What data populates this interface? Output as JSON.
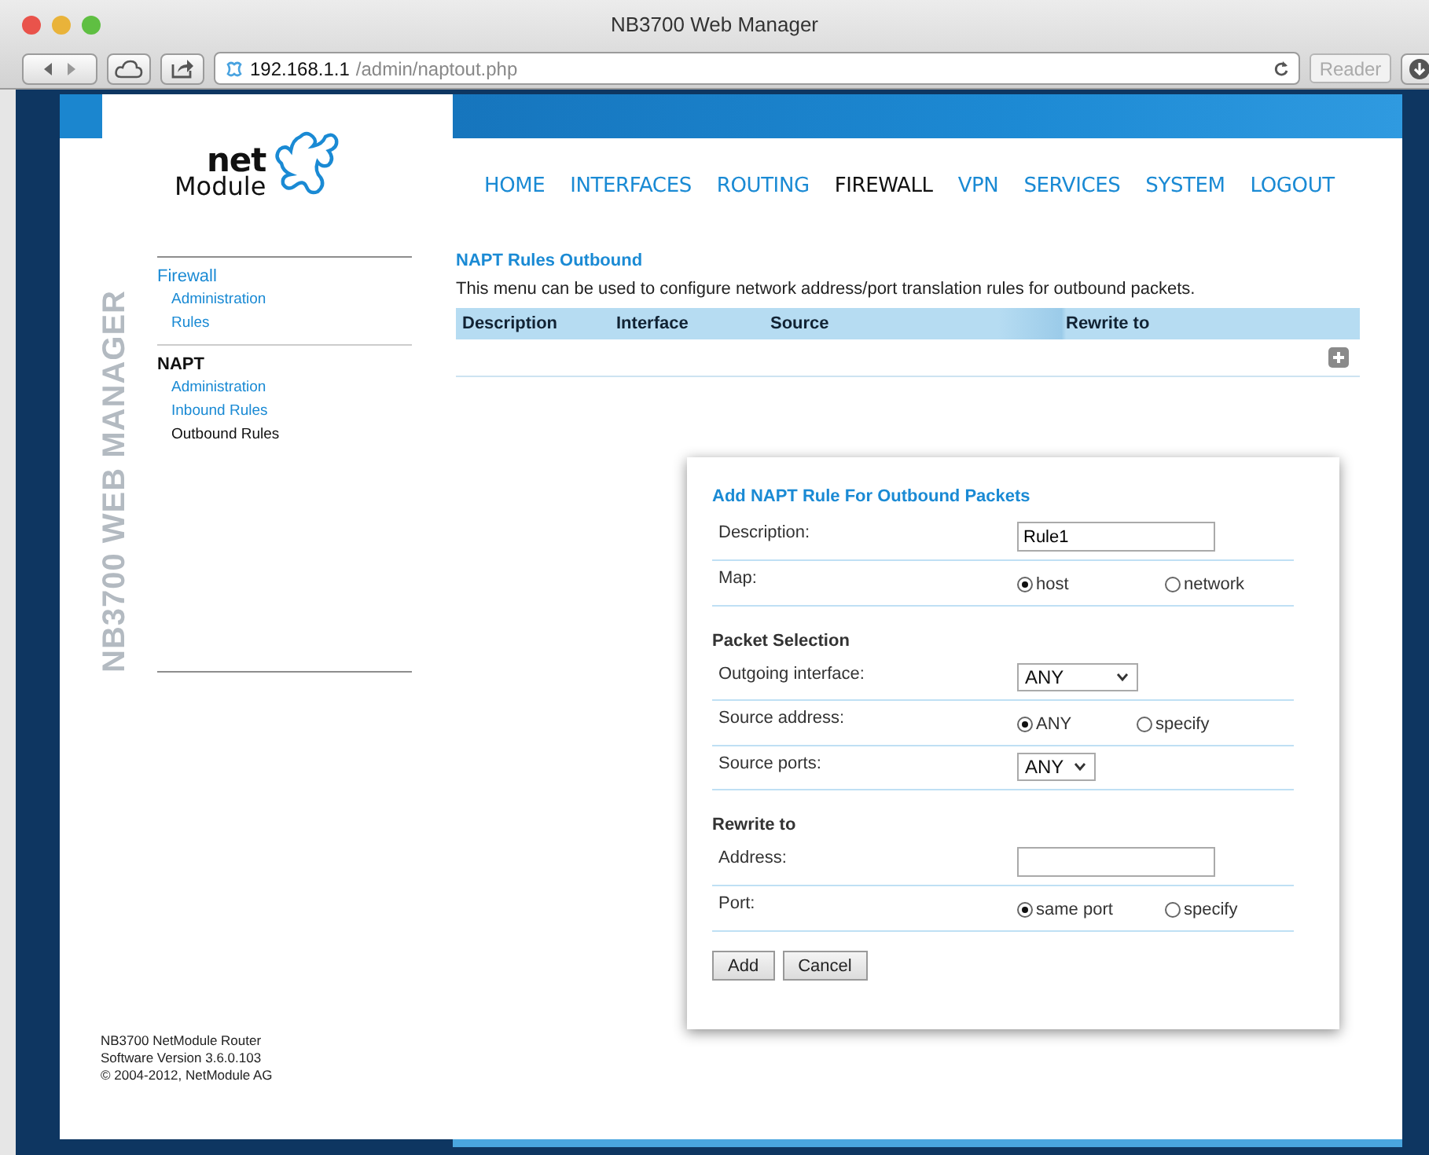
{
  "browser": {
    "title": "NB3700 Web Manager",
    "url_host": "192.168.1.1",
    "url_path": "/admin/naptout.php",
    "reader": "Reader"
  },
  "brand": {
    "logo_top": "net",
    "logo_bottom": "Module",
    "side_title": "NB3700 WEB MANAGER"
  },
  "main_menu": [
    {
      "label": "HOME",
      "selected": false
    },
    {
      "label": "INTERFACES",
      "selected": false
    },
    {
      "label": "ROUTING",
      "selected": false
    },
    {
      "label": "FIREWALL",
      "selected": true
    },
    {
      "label": "VPN",
      "selected": false
    },
    {
      "label": "SERVICES",
      "selected": false
    },
    {
      "label": "SYSTEM",
      "selected": false
    },
    {
      "label": "LOGOUT",
      "selected": false
    }
  ],
  "side_nav": [
    {
      "label": "Firewall",
      "selected": false,
      "children": [
        {
          "label": "Administration",
          "selected": false
        },
        {
          "label": "Rules",
          "selected": false
        }
      ]
    },
    {
      "label": "NAPT",
      "selected": true,
      "children": [
        {
          "label": "Administration",
          "selected": false
        },
        {
          "label": "Inbound Rules",
          "selected": false
        },
        {
          "label": "Outbound Rules",
          "selected": true
        }
      ]
    }
  ],
  "footer": [
    "NB3700 NetModule Router",
    "Software Version 3.6.0.103",
    "© 2004-2012, NetModule AG"
  ],
  "content": {
    "title": "NAPT Rules Outbound",
    "intro": "This menu can be used to configure network address/port translation rules for outbound packets.",
    "table": {
      "columns": [
        "Description",
        "Interface",
        "Source",
        "Rewrite to"
      ]
    }
  },
  "dialog": {
    "title": "Add NAPT Rule For Outbound Packets",
    "sections": [
      {
        "rows": [
          {
            "kind": "text",
            "label": "Description:",
            "value": "Rule1"
          },
          {
            "kind": "radio",
            "label": "Map:",
            "options": [
              {
                "label": "host",
                "selected": true
              },
              {
                "label": "network",
                "selected": false
              }
            ]
          }
        ]
      },
      {
        "heading": "Packet Selection",
        "rows": [
          {
            "kind": "select",
            "label": "Outgoing interface:",
            "value": "ANY",
            "wide": true
          },
          {
            "kind": "radio",
            "label": "Source address:",
            "options": [
              {
                "label": "ANY",
                "selected": true
              },
              {
                "label": "specify",
                "selected": false
              }
            ]
          },
          {
            "kind": "select",
            "label": "Source ports:",
            "value": "ANY",
            "wide": false
          }
        ]
      },
      {
        "heading": "Rewrite to",
        "rows": [
          {
            "kind": "text",
            "label": "Address:"
          },
          {
            "kind": "radio",
            "label": "Port:",
            "options": [
              {
                "label": "same port",
                "selected": true
              },
              {
                "label": "specify",
                "selected": false
              }
            ]
          }
        ]
      }
    ],
    "buttons": [
      "Add",
      "Cancel"
    ]
  }
}
